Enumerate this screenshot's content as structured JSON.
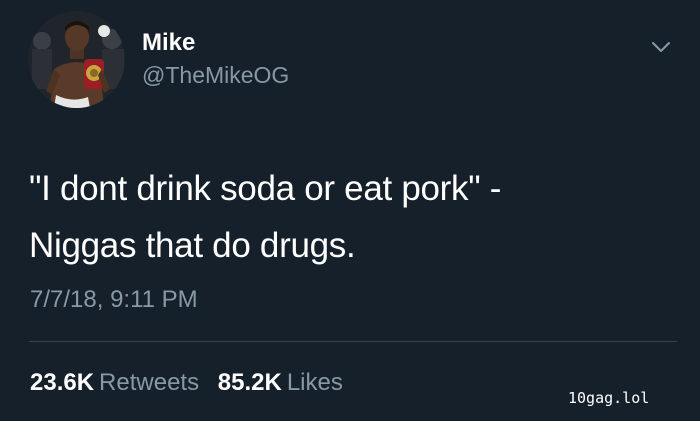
{
  "tweet": {
    "author": {
      "name": "Mike",
      "handle": "@TheMikeOG",
      "avatar_icon": "boxer-with-championship-belt"
    },
    "text_lines": [
      "\"I dont drink soda or eat pork\" -",
      "Niggas that do drugs."
    ],
    "timestamp": "7/7/18, 9:11 PM",
    "stats": {
      "retweets_count": "23.6K",
      "retweets_label": "Retweets",
      "likes_count": "85.2K",
      "likes_label": "Likes"
    },
    "menu_icon": "chevron-down-icon"
  },
  "watermark": "10gag.lol",
  "colors": {
    "background": "#15202b",
    "primary_text": "#ffffff",
    "secondary_text": "#8899a6",
    "divider": "#38444d"
  }
}
